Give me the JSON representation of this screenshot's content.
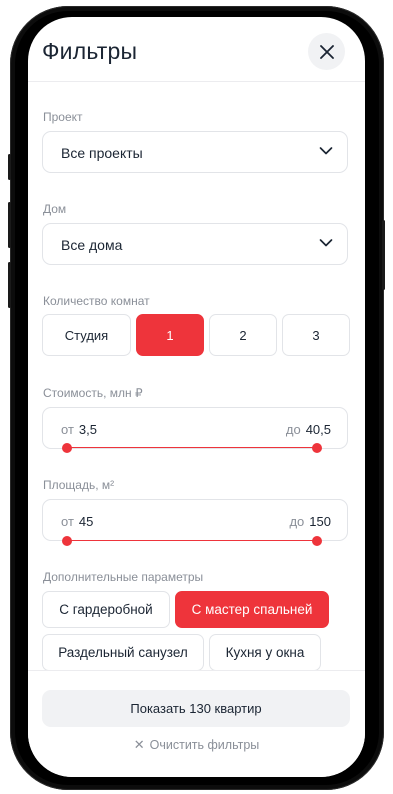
{
  "header": {
    "title": "Фильтры",
    "close_icon": "close-icon"
  },
  "project": {
    "label": "Проект",
    "value": "Все проекты",
    "icon": "chevron-down-icon"
  },
  "house": {
    "label": "Дом",
    "value": "Все дома",
    "icon": "chevron-down-icon"
  },
  "rooms": {
    "label": "Количество комнат",
    "options": [
      {
        "label": "Студия",
        "selected": false
      },
      {
        "label": "1",
        "selected": true
      },
      {
        "label": "2",
        "selected": false
      },
      {
        "label": "3",
        "selected": false
      }
    ]
  },
  "price": {
    "label": "Стоимость, млн ₽",
    "from_prefix": "от",
    "from_value": "3,5",
    "to_prefix": "до",
    "to_value": "40,5",
    "range_start_fraction": 0,
    "range_end_fraction": 1
  },
  "area": {
    "label": "Площадь, м²",
    "from_prefix": "от",
    "from_value": "45",
    "to_prefix": "до",
    "to_value": "150",
    "range_start_fraction": 0,
    "range_end_fraction": 1
  },
  "extras": {
    "label": "Дополнительные параметры",
    "chips": [
      {
        "label": "С гардеробной",
        "selected": false
      },
      {
        "label": "С мастер спальней",
        "selected": true
      },
      {
        "label": "Раздельный санузел",
        "selected": false
      },
      {
        "label": "Кухня у окна",
        "selected": false
      }
    ]
  },
  "footer": {
    "show_button": "Показать 130 квартир",
    "clear_icon": "close-icon",
    "clear_link": "Очистить фильтры"
  },
  "colors": {
    "accent": "#ee343b",
    "text": "#1b2533",
    "muted": "#8a8f98"
  }
}
